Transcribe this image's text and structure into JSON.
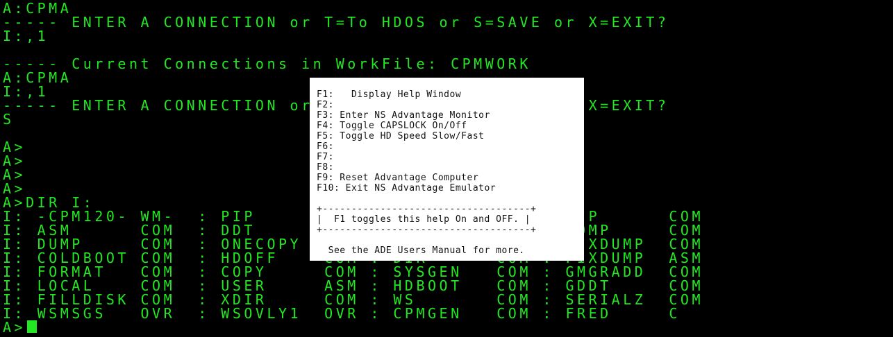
{
  "terminal": {
    "lines": [
      "A:CPMA",
      "----- ENTER A CONNECTION or T=To HDOS or S=SAVE or X=EXIT?",
      "I:,1",
      "",
      "----- Current Connections in WorkFile: CPMWORK",
      "A:CPMA",
      "I:,1",
      "----- ENTER A CONNECTION or T=To HDOS or S=SAVE or X=EXIT?",
      "S",
      "",
      "A>",
      "A>",
      "A>",
      "A>",
      "A>DIR I:",
      "I: -CPM120- WM-  : PIP      COM : DDT      COM : PIP      COM",
      "I: ASM      COM  : DDT      COM : STAT     COM : COMP     COM",
      "I: DUMP     COM  : ONECOPY  COM : SUBMIT   COM : FIXDUMP  COM",
      "I: COLDBOOT COM  : HDOFF    COM : DIR      COM : FIXDUMP  ASM",
      "I: FORMAT   COM  : COPY     COM : SYSGEN   COM : GMGRADD  COM",
      "I: LOCAL    COM  : USER     ASM : HDBOOT   COM : GDDT     COM",
      "I: FILLDISK COM  : XDIR     COM : WS       COM : SERIALZ  COM",
      "I: WSMSGS   OVR  : WSOVLY1  OVR : CPMGEN   COM : FRED     C"
    ],
    "prompt": "A>"
  },
  "help_window": {
    "keys": [
      "F1:   Display Help Window",
      "F2:",
      "F3: Enter NS Advantage Monitor",
      "F4: Toggle CAPSLOCK On/Off",
      "F5: Toggle HD Speed Slow/Fast",
      "F6:",
      "F7:",
      "F8:",
      "F9: Reset Advantage Computer",
      "F10: Exit NS Advantage Emulator"
    ],
    "box_top": "+------------------------------------+",
    "box_text": "|  F1 toggles this help On and OFF. |",
    "box_bottom": "+------------------------------------+",
    "footer": "  See the ADE Users Manual for more."
  },
  "colors": {
    "terminal_text": "#22e822",
    "terminal_bg": "#000000",
    "help_bg": "#ffffff",
    "help_text": "#111111"
  }
}
